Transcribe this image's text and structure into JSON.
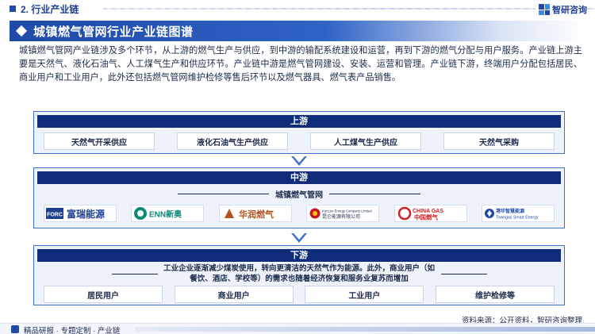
{
  "header": {
    "section": "2. 行业产业链",
    "brand": "智研咨询"
  },
  "title": "城镇燃气管网行业产业链图谱",
  "intro": "城镇燃气管网产业链涉及多个环节，从上游的燃气生产与供应，到中游的输配系统建设和运营，再到下游的燃气分配与用户服务。产业链上游主要是天然气、液化石油气、人工煤气生产和供应环节。产业链中游是燃气管网建设、安装、运营和管理。产业链下游，终端用户分配包括居民、商业用户和工业用户，此外还包括燃气管网维护检修等售后环节以及燃气器具、燃气表产品销售。",
  "upstream": {
    "label": "上游",
    "items": [
      "天然气开采供应",
      "液化石油气生产供应",
      "人工煤气生产供应",
      "天然气采购"
    ]
  },
  "midstream": {
    "label": "中游",
    "subtitle": "城镇燃气管网",
    "companies": [
      {
        "name": "富瑞能源",
        "mark": "FORC",
        "icon": "foric-logo-icon",
        "color": "#1f3f8f"
      },
      {
        "name": "ENN新奥",
        "mark": "ENN",
        "icon": "enn-logo-icon",
        "color": "#0a8a7a"
      },
      {
        "name": "华润燃气",
        "mark": "",
        "icon": "china-resources-gas-logo-icon",
        "color": "#b5531f"
      },
      {
        "name": "昆仑能源有限公司",
        "mark": "KunLun Energy Company Limited",
        "icon": "kunlun-energy-logo-icon",
        "color": "#c8161d"
      },
      {
        "name": "中国燃气",
        "mark": "CHINA GAS",
        "icon": "china-gas-logo-icon",
        "color": "#d01f27"
      },
      {
        "name": "港华智慧能源",
        "mark": "Towngas Smart Energy",
        "icon": "towngas-logo-icon",
        "color": "#1f4aa8"
      }
    ]
  },
  "downstream": {
    "label": "下游",
    "subtitle": "工业企业逐渐减少煤炭使用，转向更清洁的天然气作为能源。此外，商业用户（如餐饮、酒店、学校等）的需求也随着经济恢复和服务业复苏而增加",
    "items": [
      "居民用户",
      "商业用户",
      "工业用户",
      "维护检修等"
    ]
  },
  "source": "资料来源：公开资料，智研咨询整理",
  "footer": "精品研报 · 专题定制 · 产业链",
  "colors": {
    "primary": "#1f4aa8",
    "dark": "#0f2c7a",
    "border": "#3f6fc9",
    "panel": "#eef3fb"
  }
}
